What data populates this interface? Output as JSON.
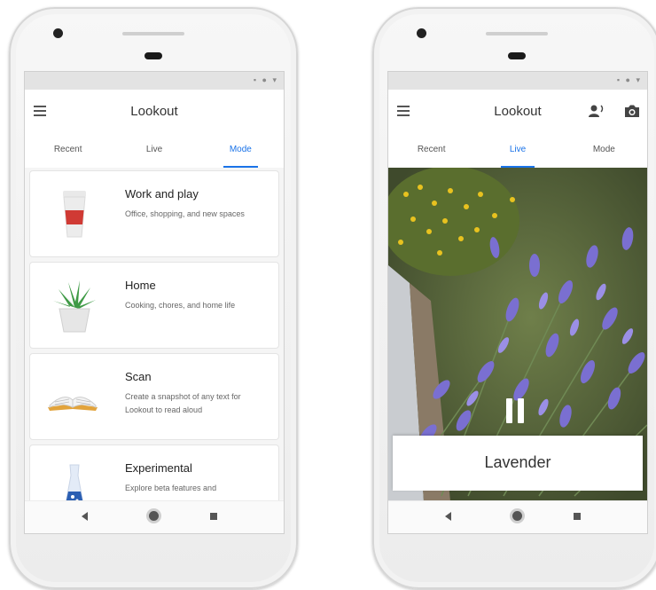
{
  "app": {
    "title": "Lookout"
  },
  "tabs": [
    "Recent",
    "Live",
    "Mode"
  ],
  "left_screen": {
    "active_tab": "Mode",
    "modes": [
      {
        "title": "Work and play",
        "description": "Office, shopping, and new spaces",
        "illustration": "coffee-cup-icon"
      },
      {
        "title": "Home",
        "description": "Cooking, chores, and home life",
        "illustration": "potted-plant-icon"
      },
      {
        "title": "Scan",
        "description": "Create a snapshot of any text for Lookout to read aloud",
        "illustration": "open-book-icon"
      },
      {
        "title": "Experimental",
        "description": "Explore beta features and",
        "illustration": "lab-flask-icon"
      }
    ]
  },
  "right_screen": {
    "active_tab": "Live",
    "detected_label": "Lavender",
    "toolbar_icons": [
      "person-voice-icon",
      "camera-icon"
    ],
    "controls": [
      "pause-icon"
    ]
  },
  "colors": {
    "accent": "#1a73e8",
    "lavender": "#7a6fd1",
    "foliage": "#5e7a3a"
  }
}
